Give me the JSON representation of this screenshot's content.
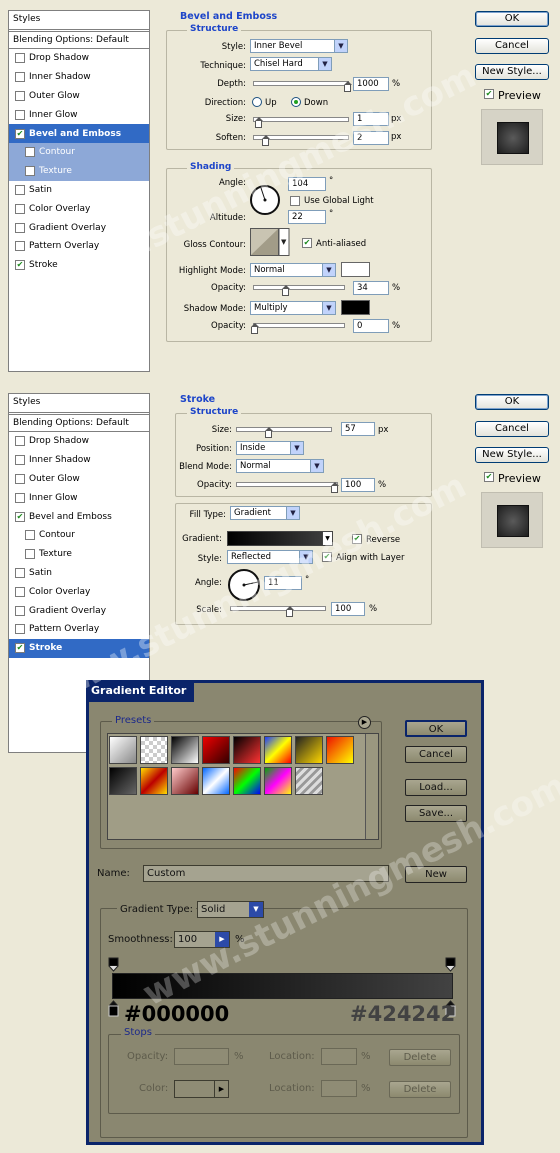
{
  "top": {
    "styles_header": "Styles",
    "blending": "Blending Options: Default",
    "items": [
      {
        "label": "Drop Shadow",
        "checked": false
      },
      {
        "label": "Inner Shadow",
        "checked": false
      },
      {
        "label": "Outer Glow",
        "checked": false
      },
      {
        "label": "Inner Glow",
        "checked": false
      },
      {
        "label": "Bevel and Emboss",
        "checked": true
      },
      {
        "label": "Contour",
        "checked": false
      },
      {
        "label": "Texture",
        "checked": false
      },
      {
        "label": "Satin",
        "checked": false
      },
      {
        "label": "Color Overlay",
        "checked": false
      },
      {
        "label": "Gradient Overlay",
        "checked": false
      },
      {
        "label": "Pattern Overlay",
        "checked": false
      },
      {
        "label": "Stroke",
        "checked": true
      }
    ],
    "title": "Bevel and Emboss",
    "structure": "Structure",
    "style_lbl": "Style:",
    "style_val": "Inner Bevel",
    "technique_lbl": "Technique:",
    "technique_val": "Chisel Hard",
    "depth_lbl": "Depth:",
    "depth_val": "1000",
    "depth_unit": "%",
    "direction_lbl": "Direction:",
    "up": "Up",
    "down": "Down",
    "size_lbl": "Size:",
    "size_val": "1",
    "px": "px",
    "soften_lbl": "Soften:",
    "soften_val": "2",
    "shading": "Shading",
    "angle_lbl": "Angle:",
    "angle_val": "104",
    "deg": "°",
    "global_light": "Use Global Light",
    "altitude_lbl": "Altitude:",
    "altitude_val": "22",
    "gloss_lbl": "Gloss Contour:",
    "anti": "Anti-aliased",
    "hl_mode_lbl": "Highlight Mode:",
    "hl_mode_val": "Normal",
    "hl_opacity_lbl": "Opacity:",
    "hl_opacity_val": "34",
    "pct": "%",
    "sh_mode_lbl": "Shadow Mode:",
    "sh_mode_val": "Multiply",
    "sh_opacity_lbl": "Opacity:",
    "sh_opacity_val": "0"
  },
  "buttons": {
    "ok": "OK",
    "cancel": "Cancel",
    "new_style": "New Style...",
    "preview": "Preview"
  },
  "bottom": {
    "styles_header": "Styles",
    "blending": "Blending Options: Default",
    "items": [
      {
        "label": "Drop Shadow",
        "checked": false
      },
      {
        "label": "Inner Shadow",
        "checked": false
      },
      {
        "label": "Outer Glow",
        "checked": false
      },
      {
        "label": "Inner Glow",
        "checked": false
      },
      {
        "label": "Bevel and Emboss",
        "checked": true
      },
      {
        "label": "Contour",
        "checked": false
      },
      {
        "label": "Texture",
        "checked": false
      },
      {
        "label": "Satin",
        "checked": false
      },
      {
        "label": "Color Overlay",
        "checked": false
      },
      {
        "label": "Gradient Overlay",
        "checked": false
      },
      {
        "label": "Pattern Overlay",
        "checked": false
      },
      {
        "label": "Stroke",
        "checked": true
      }
    ],
    "title": "Stroke",
    "structure": "Structure",
    "size_lbl": "Size:",
    "size_val": "57",
    "px": "px",
    "position_lbl": "Position:",
    "position_val": "Inside",
    "blend_lbl": "Blend Mode:",
    "blend_val": "Normal",
    "opacity_lbl": "Opacity:",
    "opacity_val": "100",
    "pct": "%",
    "fill_lbl": "Fill Type:",
    "fill_val": "Gradient",
    "gradient_lbl": "Gradient:",
    "reverse": "Reverse",
    "style_lbl": "Style:",
    "style_val": "Reflected",
    "align": "Align with Layer",
    "angle_lbl": "Angle:",
    "angle_val": "11",
    "deg": "°",
    "scale_lbl": "Scale:",
    "scale_val": "100"
  },
  "editor": {
    "title": "Gradient Editor",
    "presets": "Presets",
    "ok": "OK",
    "cancel": "Cancel",
    "load": "Load...",
    "save": "Save...",
    "name_lbl": "Name:",
    "name_val": "Custom",
    "new": "New",
    "type_lbl": "Gradient Type:",
    "type_val": "Solid",
    "smooth_lbl": "Smoothness:",
    "smooth_val": "100",
    "pct": "%",
    "left_hex": "#000000",
    "right_hex": "#424242",
    "stops": "Stops",
    "opacity_lbl": "Opacity:",
    "location_lbl": "Location:",
    "delete": "Delete",
    "color_lbl": "Color:",
    "location2_lbl": "Location:",
    "delete2": "Delete"
  },
  "watermark": "www.stunningmesh.com",
  "colors": {
    "accent": "#316ac5",
    "title_blue": "#1d45c9",
    "editor_bg": "#8a8770",
    "editor_border": "#0a246a",
    "grad_left": "#000000",
    "grad_right": "#424242"
  }
}
